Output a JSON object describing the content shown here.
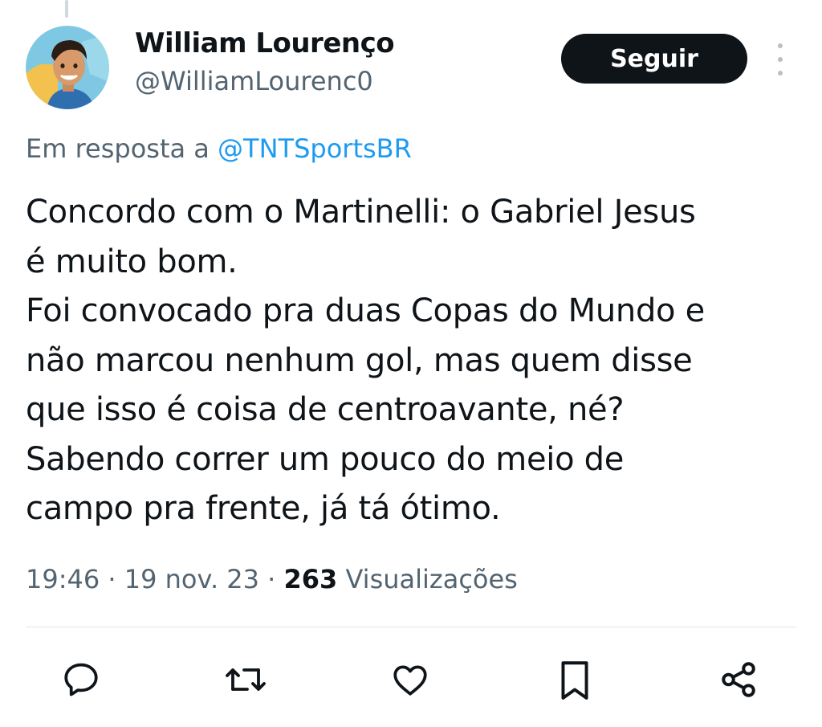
{
  "author": {
    "display_name": "William Lourenço",
    "handle": "@WilliamLourenc0",
    "avatar_icon": "cartoon-avatar-icon"
  },
  "follow_label": "Seguir",
  "more_icon": "more-vertical-icon",
  "reply_context": {
    "prefix": "Em resposta a ",
    "mention": "@TNTSportsBR"
  },
  "tweet": {
    "text": "Concordo com o Martinelli: o Gabriel Jesus\né muito bom.\nFoi convocado pra duas Copas do Mundo e\nnão marcou nenhum gol, mas quem disse\nque isso é coisa de centroavante, né?\nSabendo correr um pouco do meio de\ncampo pra frente, já tá ótimo."
  },
  "meta": {
    "time": "19:46",
    "separator1": " · ",
    "date": "19 nov. 23",
    "separator2": " · ",
    "views_count": "263",
    "views_label": " Visualizações"
  },
  "actions": [
    {
      "icon": "reply-icon"
    },
    {
      "icon": "retweet-icon"
    },
    {
      "icon": "like-icon"
    },
    {
      "icon": "bookmark-icon"
    },
    {
      "icon": "share-icon"
    }
  ],
  "colors": {
    "accent": "#1d9bf0",
    "text_primary": "#0f1419",
    "text_secondary": "#536471",
    "button_bg": "#0f1419"
  }
}
